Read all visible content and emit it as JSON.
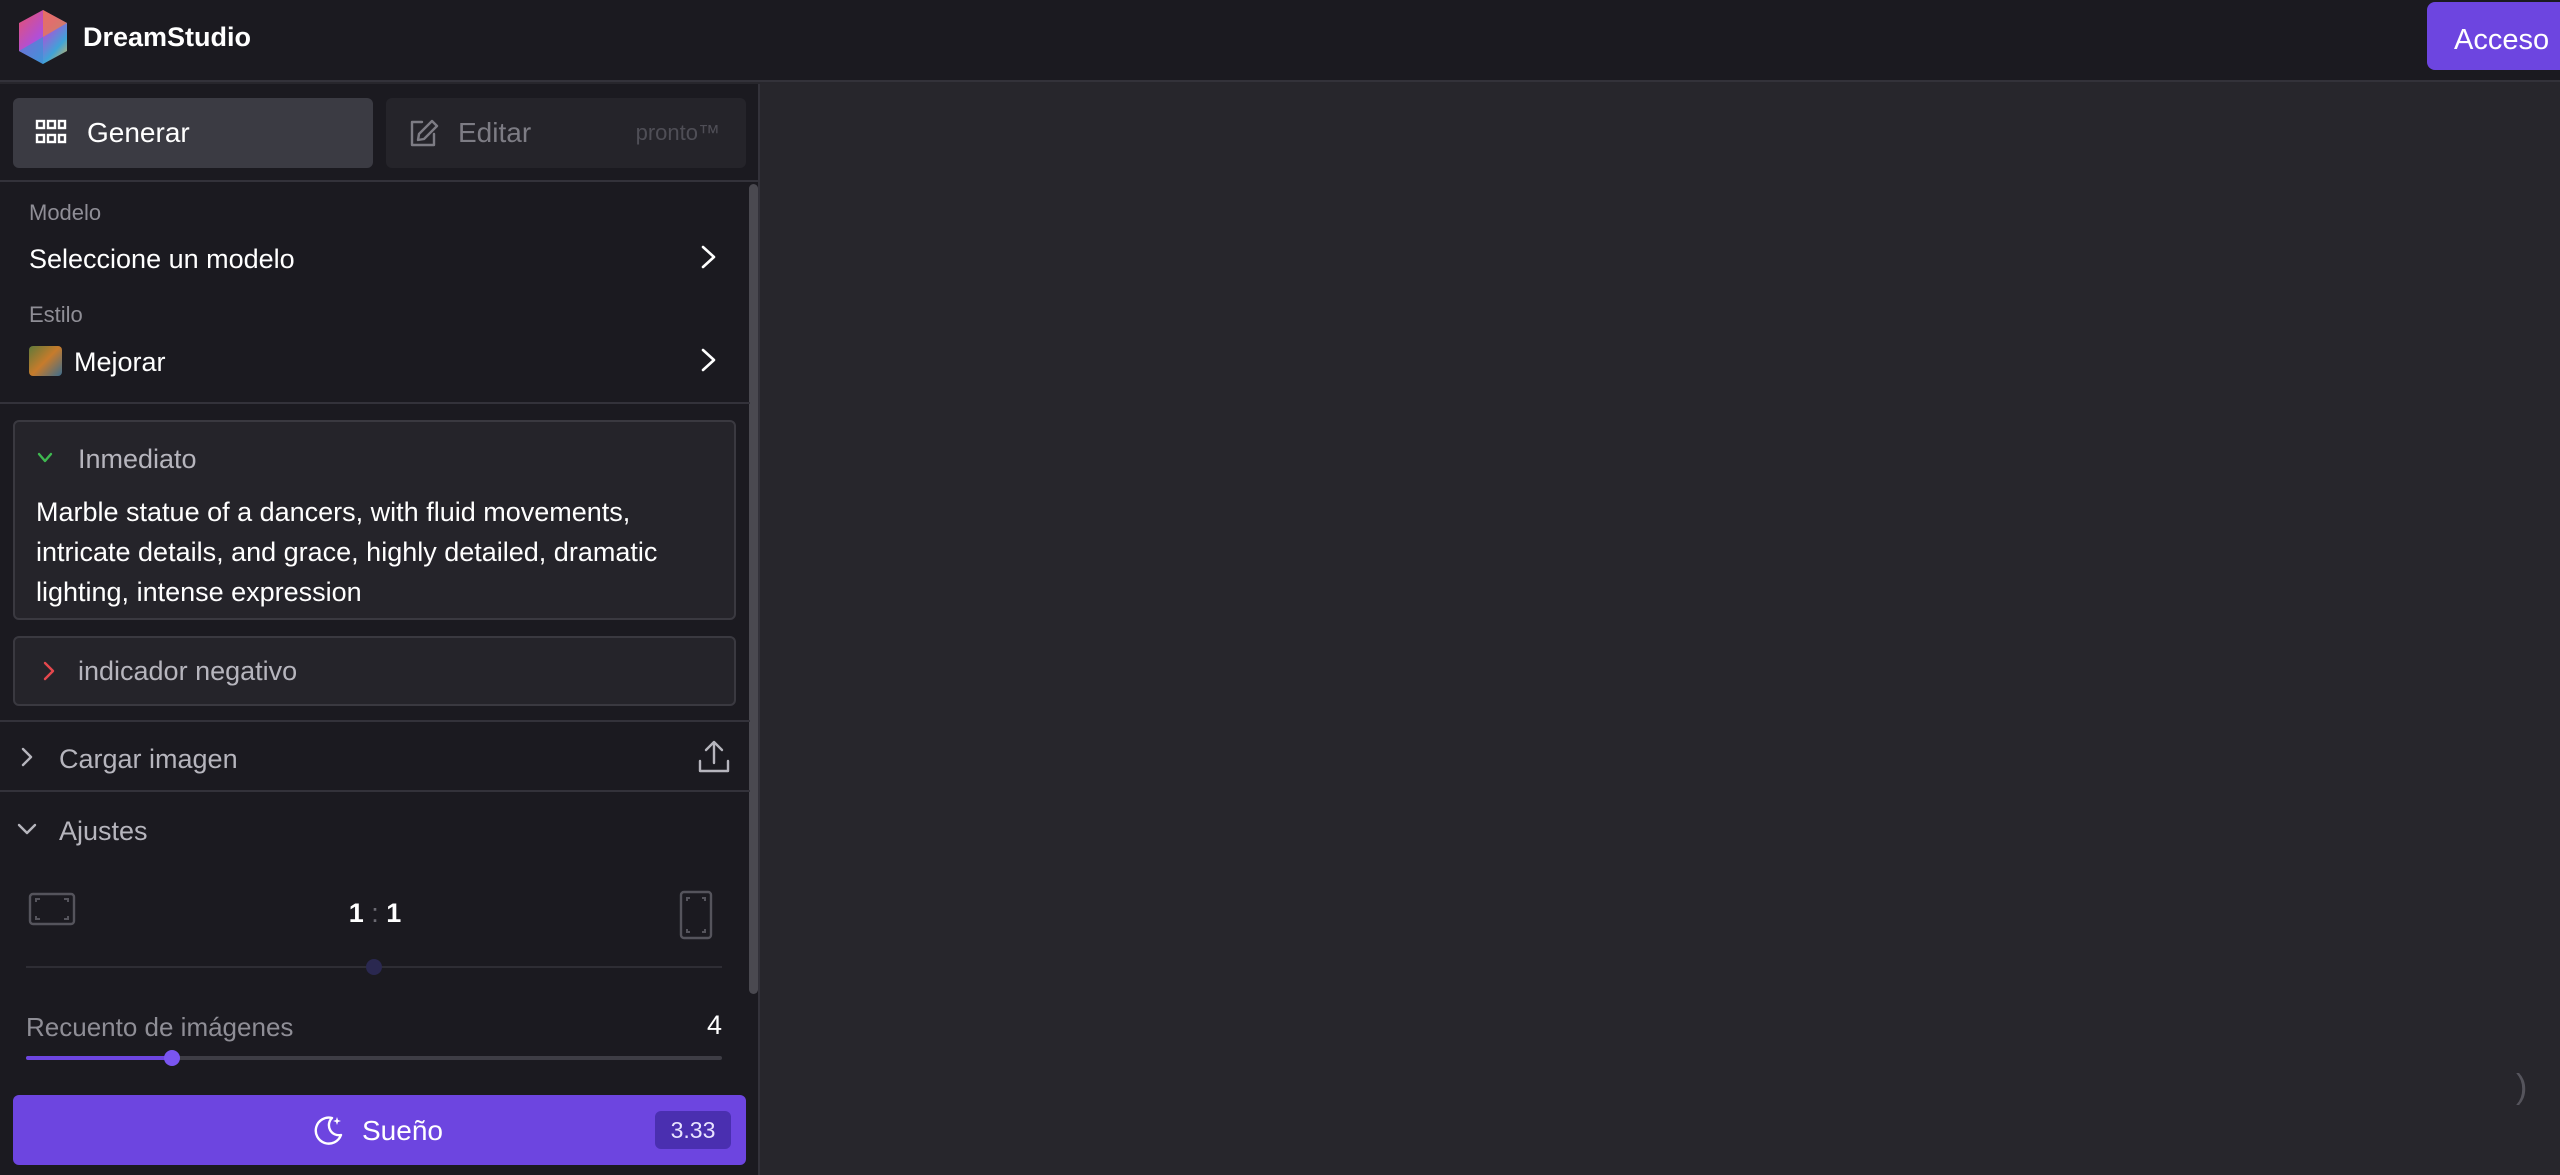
{
  "app": {
    "brand": "DreamStudio"
  },
  "header": {
    "login_label": "Acceso"
  },
  "tabs": {
    "generate_label": "Generar",
    "edit_label": "Editar",
    "edit_badge": "pronto™"
  },
  "model": {
    "label": "Modelo",
    "value": "Seleccione un modelo"
  },
  "style": {
    "label": "Estilo",
    "value": "Mejorar"
  },
  "prompt": {
    "label": "Inmediato",
    "text": "Marble statue of a dancers, with fluid movements, intricate details, and grace, highly detailed, dramatic lighting, intense expression"
  },
  "negative_prompt": {
    "label": "indicador negativo"
  },
  "upload": {
    "label": "Cargar imagen"
  },
  "settings": {
    "label": "Ajustes",
    "ratio_w": "1",
    "ratio_sep": ":",
    "ratio_h": "1",
    "image_count_label": "Recuento de imágenes",
    "image_count_value": "4",
    "image_count_fraction": 0.21
  },
  "dream_button": {
    "label": "Sueño",
    "cost": "3.33"
  },
  "canvas": {
    "corner_glyph": ")"
  },
  "colors": {
    "accent": "#6d45e0",
    "prompt_chevron": "#3fb950",
    "negative_chevron": "#e5484d",
    "background": "#27262c",
    "sidebar": "#1b1a20"
  },
  "icons": {
    "logo": "dreamstudio-logo",
    "generate": "grid-icon",
    "edit": "pencil-square-icon",
    "upload": "upload-icon",
    "dream": "moon-sparkle-icon",
    "ratio_landscape": "landscape-frame-icon",
    "ratio_portrait": "portrait-frame-icon"
  }
}
